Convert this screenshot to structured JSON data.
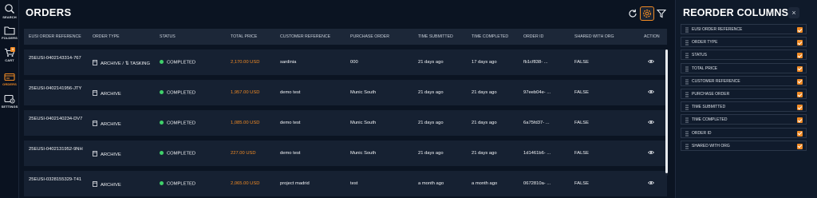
{
  "nav": {
    "items": [
      {
        "label": "SEARCH",
        "icon": "search-icon"
      },
      {
        "label": "FOLDERS",
        "icon": "folder-icon"
      },
      {
        "label": "CART",
        "icon": "cart-icon",
        "badge": "3"
      },
      {
        "label": "ORDERS",
        "icon": "orders-icon",
        "active": true
      },
      {
        "label": "SETTINGS",
        "icon": "settings-icon"
      }
    ]
  },
  "header": {
    "title": "ORDERS",
    "refresh_icon": "refresh-icon",
    "columns_icon": "column-settings-icon",
    "filter_icon": "filter-icon"
  },
  "table": {
    "columns": [
      "EUSI ORDER REFERENCE",
      "ORDER TYPE",
      "STATUS",
      "TOTAL PRICE",
      "CUSTOMER REFERENCE",
      "PURCHASE ORDER",
      "TIME SUBMITTED",
      "TIME COMPLETED",
      "ORDER ID",
      "SHARED WITH ORG",
      "ACTION"
    ],
    "rows": [
      {
        "ref": "25EUSI-0402143314-767",
        "type": "ARCHIVE / ⇅ TASKING",
        "status": "COMPLETED",
        "price": "2,170.00 USD",
        "customer_ref": "sardinia",
        "po": "000",
        "submitted": "21 days ago",
        "completed": "17 days ago",
        "order_id": "fb1cf838- ...",
        "shared": "FALSE"
      },
      {
        "ref": "25EUSI-0402141956-JTY",
        "type": "ARCHIVE",
        "status": "COMPLETED",
        "price": "1,957.00 USD",
        "customer_ref": "demo test",
        "po": "Munic South",
        "submitted": "21 days ago",
        "completed": "21 days ago",
        "order_id": "97eeb04e- ...",
        "shared": "FALSE"
      },
      {
        "ref": "25EUSI-0402140234-DV7",
        "type": "ARCHIVE",
        "status": "COMPLETED",
        "price": "1,085.00 USD",
        "customer_ref": "demo test",
        "po": "Munic South",
        "submitted": "21 days ago",
        "completed": "21 days ago",
        "order_id": "6a75fd37- ...",
        "shared": "FALSE"
      },
      {
        "ref": "25EUSI-0402131952-9NH",
        "type": "ARCHIVE",
        "status": "COMPLETED",
        "price": "227.00 USD",
        "customer_ref": "demo test",
        "po": "Munic South",
        "submitted": "21 days ago",
        "completed": "21 days ago",
        "order_id": "1d1461b6- ...",
        "shared": "FALSE"
      },
      {
        "ref": "25EUSI-0328155329-T41",
        "type": "ARCHIVE",
        "status": "COMPLETED",
        "price": "2,065.00 USD",
        "customer_ref": "project madrid",
        "po": "test",
        "submitted": "a month ago",
        "completed": "a month ago",
        "order_id": "0672810a- ...",
        "shared": "FALSE"
      }
    ],
    "action_icon": "eye-icon"
  },
  "panel": {
    "title": "REORDER COLUMNS",
    "close_label": "×",
    "items": [
      {
        "label": "EUSI ORDER REFERENCE",
        "checked": true
      },
      {
        "label": "ORDER TYPE",
        "checked": true
      },
      {
        "label": "STATUS",
        "checked": true
      },
      {
        "label": "TOTAL PRICE",
        "checked": true
      },
      {
        "label": "CUSTOMER REFERENCE",
        "checked": true
      },
      {
        "label": "PURCHASE ORDER",
        "checked": true
      },
      {
        "label": "TIME SUBMITTED",
        "checked": true
      },
      {
        "label": "TIME COMPLETED",
        "checked": true
      },
      {
        "label": "ORDER ID",
        "checked": true
      },
      {
        "label": "SHARED WITH ORG",
        "checked": true
      }
    ]
  },
  "colors": {
    "accent": "#f08a24",
    "background": "#0b1422",
    "row": "#162132",
    "header_row": "#1c2738",
    "status_ok": "#3fd06a"
  }
}
